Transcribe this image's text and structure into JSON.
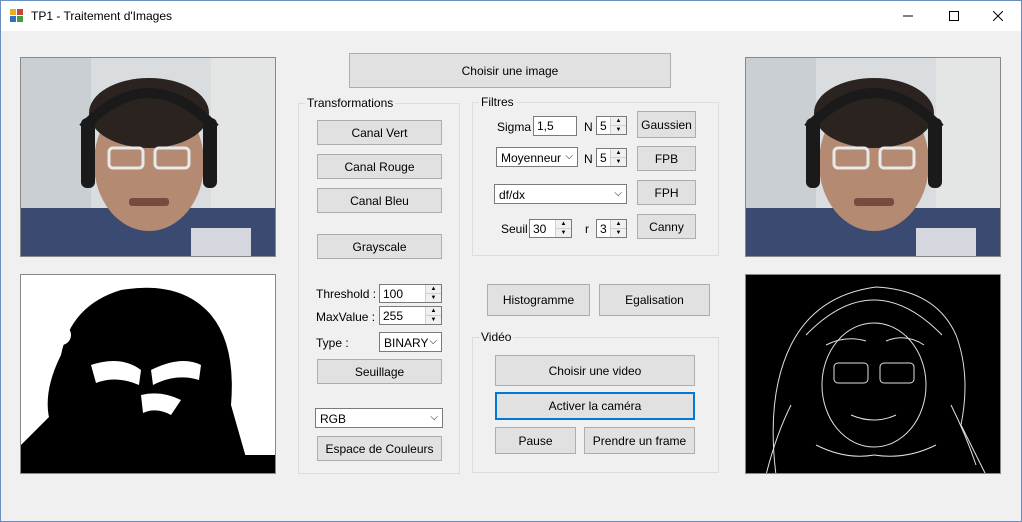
{
  "window": {
    "title": "TP1 - Traitement d'Images",
    "min": "—",
    "max": "☐",
    "close": "✕"
  },
  "top": {
    "choose_image": "Choisir une image"
  },
  "transformations": {
    "title": "Transformations",
    "canal_vert": "Canal Vert",
    "canal_rouge": "Canal Rouge",
    "canal_bleu": "Canal Bleu",
    "grayscale": "Grayscale",
    "threshold_label": "Threshold :",
    "threshold_value": "100",
    "maxvalue_label": "MaxValue :",
    "maxvalue_value": "255",
    "type_label": "Type :",
    "type_value": "BINARY",
    "seuillage": "Seuillage",
    "colorspace_value": "RGB",
    "espace_couleurs": "Espace de Couleurs"
  },
  "filtres": {
    "title": "Filtres",
    "sigma_label": "Sigma",
    "sigma_value": "1,5",
    "n_label": "N",
    "n_value_1": "5",
    "gaussien": "Gaussien",
    "filter_value": "Moyenneur",
    "n_label_2": "N",
    "n_value_2": "5",
    "fpb": "FPB",
    "derivative_value": "df/dx",
    "fph": "FPH",
    "seuil_label": "Seuil",
    "seuil_value": "30",
    "r_label": "r",
    "r_value": "3",
    "canny": "Canny"
  },
  "hist": {
    "histogramme": "Histogramme",
    "egalisation": "Egalisation"
  },
  "video": {
    "title": "Vidéo",
    "choose_video": "Choisir une video",
    "activate_camera": "Activer la caméra",
    "pause": "Pause",
    "take_frame": "Prendre un frame"
  },
  "icons": {
    "app": "app-icon",
    "spin_up": "▲",
    "spin_down": "▼",
    "chevron": "⌵"
  }
}
